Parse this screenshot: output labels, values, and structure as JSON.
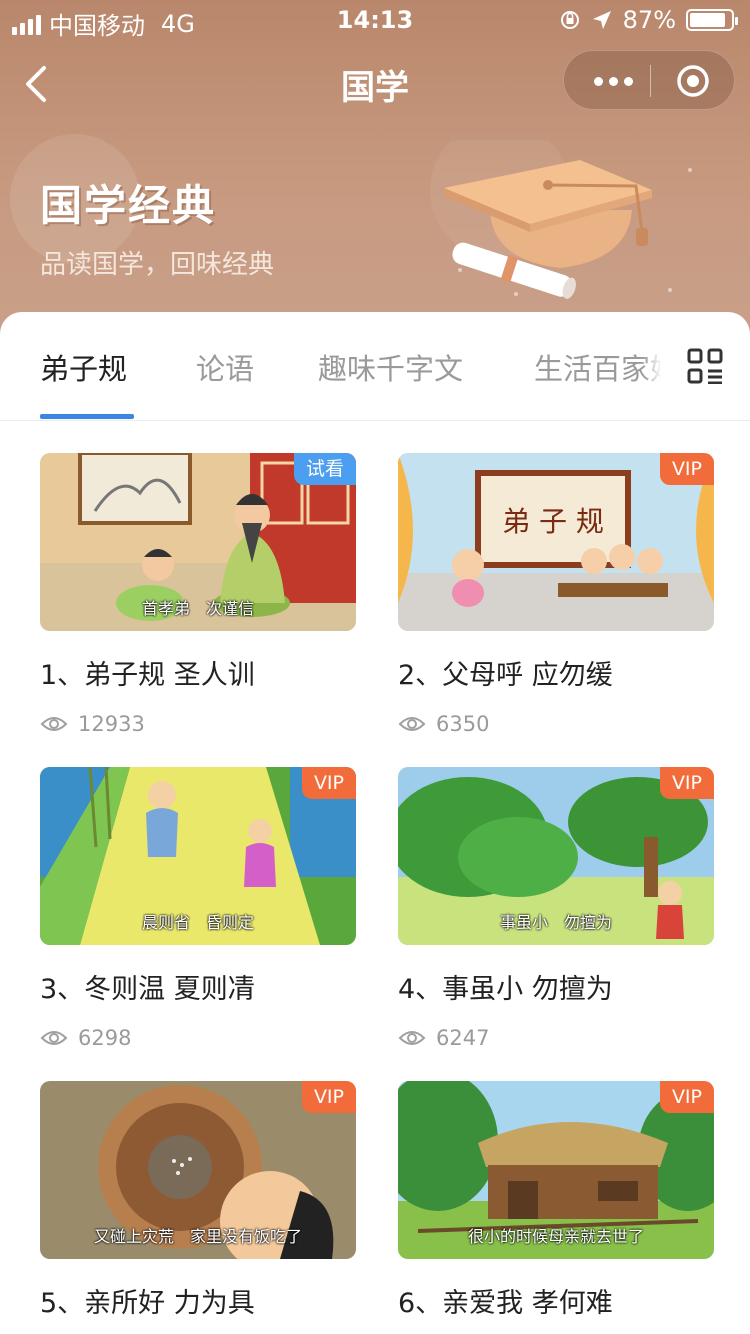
{
  "status_bar": {
    "carrier": "中国移动",
    "network": "4G",
    "time": "14:13",
    "battery": "87%",
    "battery_level": 0.87
  },
  "nav": {
    "title": "国学"
  },
  "hero": {
    "title": "国学经典",
    "subtitle": "品读国学，回味经典"
  },
  "tabs": [
    {
      "label": "弟子规",
      "active": true
    },
    {
      "label": "论语",
      "active": false
    },
    {
      "label": "趣味千字文",
      "active": false
    },
    {
      "label": "生活百家姓",
      "active": false
    }
  ],
  "videos": [
    {
      "title": "1、弟子规 圣人训",
      "views": "12933",
      "badge": "试看",
      "badge_color": "#4c9ef0",
      "caption": "首孝弟　次谨信"
    },
    {
      "title": "2、父母呼 应勿缓",
      "views": "6350",
      "badge": "VIP",
      "badge_color": "#f26b3a",
      "caption": ""
    },
    {
      "title": "3、冬则温 夏则凊",
      "views": "6298",
      "badge": "VIP",
      "badge_color": "#f26b3a",
      "caption": "晨则省　昏则定"
    },
    {
      "title": "4、事虽小 勿擅为",
      "views": "6247",
      "badge": "VIP",
      "badge_color": "#f26b3a",
      "caption": "事虽小　勿擅为"
    },
    {
      "title": "5、亲所好 力为具",
      "views": "",
      "badge": "VIP",
      "badge_color": "#f26b3a",
      "caption": "又碰上灾荒　家里没有饭吃了"
    },
    {
      "title": "6、亲爱我 孝何难",
      "views": "",
      "badge": "VIP",
      "badge_color": "#f26b3a",
      "caption": "很小的时候母亲就去世了"
    }
  ],
  "colors": {
    "accent": "#3b86e0",
    "header_brown": "#b9876b",
    "vip": "#f26b3a",
    "trial": "#4c9ef0"
  }
}
